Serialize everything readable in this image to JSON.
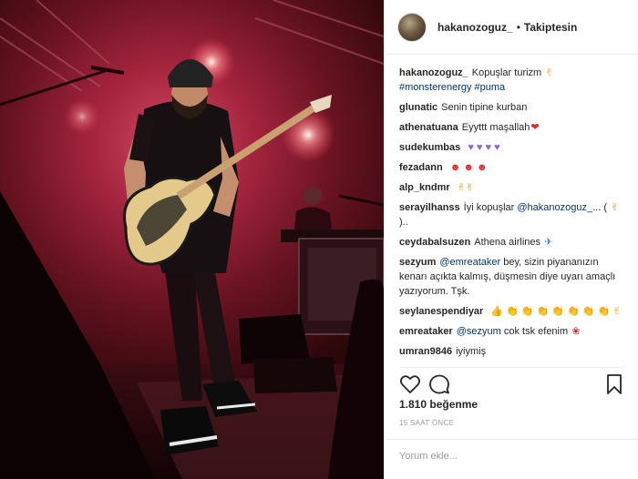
{
  "post": {
    "username": "hakanozoguz_",
    "dot": "•",
    "follow_label": "Takiptesin",
    "likes": "1.810 beğenme",
    "time": "15 SAAT ÖNCE",
    "add_comment_placeholder": "Yorum ekle..."
  },
  "caption": {
    "user": "hakanozoguz_",
    "text": "Kopuşlar turizm",
    "tags": "#monsterenergy #puma"
  },
  "comments": [
    {
      "user": "glunatic",
      "text": "Senin tipine kurban"
    },
    {
      "user": "athenatuana",
      "text": "Eyyttt maşallah"
    },
    {
      "user": "sudekumbas",
      "text": ""
    },
    {
      "user": "fezadann",
      "text": ""
    },
    {
      "user": "alp_kndmr",
      "text": ""
    },
    {
      "user": "serayilhanss",
      "text": "İyi kopuşlar",
      "mention": "@hakanozoguz_",
      "tail": "... ( ",
      "tail2": ").."
    },
    {
      "user": "ceydabalsuzen",
      "text": "Athena airlines"
    },
    {
      "user": "sezyum",
      "mention": "@emreataker",
      "text": "bey, sizin piyananızın kenarı açıkta kalmış, düşmesin diye uyarı amaçlı yazıyorum. Tşk."
    },
    {
      "user": "seylanespendiyar",
      "text": ""
    },
    {
      "user": "emreataker",
      "mention": "@sezyum",
      "text": "cok tsk efenim"
    },
    {
      "user": "umran9846",
      "text": "iyiymiş"
    }
  ],
  "icons": {
    "heart": "heart-icon",
    "comment": "comment-icon",
    "bookmark": "bookmark-icon"
  },
  "colors": {
    "text": "#262626",
    "hashtag": "#003569",
    "muted": "#999999",
    "border": "#efefef"
  }
}
